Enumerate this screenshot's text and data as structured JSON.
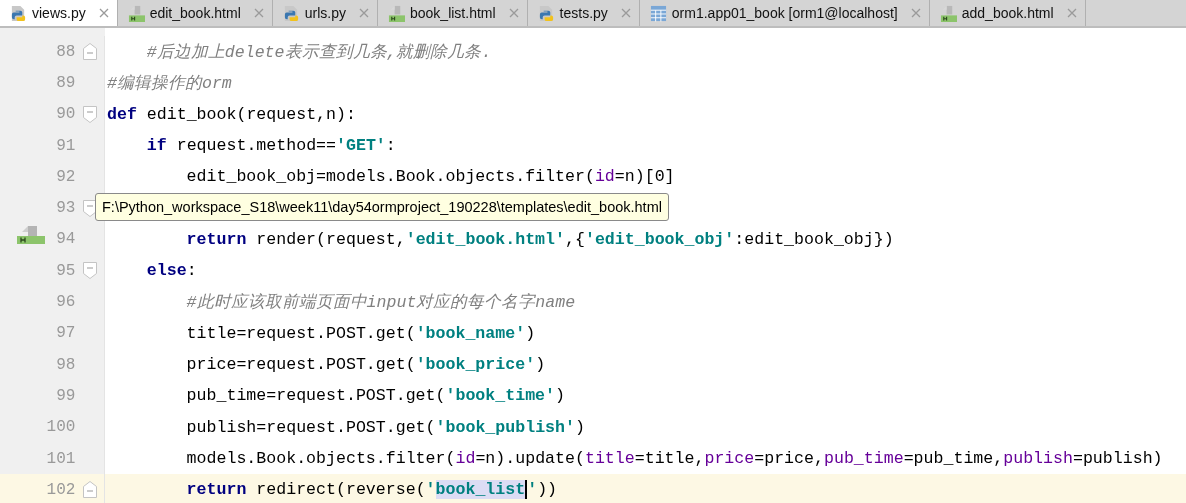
{
  "tabs": [
    {
      "label": "views.py",
      "kind": "python",
      "selected": true
    },
    {
      "label": "edit_book.html",
      "kind": "html",
      "selected": false
    },
    {
      "label": "urls.py",
      "kind": "python",
      "selected": false
    },
    {
      "label": "book_list.html",
      "kind": "html",
      "selected": false
    },
    {
      "label": "tests.py",
      "kind": "python",
      "selected": false
    },
    {
      "label": "orm1.app01_book [orm1@localhost]",
      "kind": "table",
      "selected": false
    },
    {
      "label": "add_book.html",
      "kind": "html",
      "selected": false
    }
  ],
  "blocks": [
    {
      "children": [
        {
          "number": "88",
          "gutter_icon": {
            "kind": "fold_end"
          },
          "tokens": [
            {
              "kind": "comment",
              "text": "#后边加上delete表示查到几条,就删除几条."
            }
          ]
        }
      ]
    },
    {
      "number": "89",
      "tokens": [
        {
          "kind": "comment",
          "text": "#编辑操作的orm"
        }
      ]
    },
    {
      "number": "90",
      "gutter_icon": {
        "kind": "fold_start"
      },
      "tokens": [
        {
          "kind": "keyword",
          "text": "def"
        },
        {
          "kind": "plain",
          "text": " edit_book(request,n):"
        }
      ],
      "children": [
        {
          "number": "91",
          "tokens": [
            {
              "kind": "keyword",
              "text": "if"
            },
            {
              "kind": "plain",
              "text": " request.method=="
            },
            {
              "kind": "string",
              "text": "'GET'"
            },
            {
              "kind": "plain",
              "text": ":"
            }
          ],
          "children": [
            {
              "number": "92",
              "tokens": [
                {
                  "kind": "plain",
                  "text": "edit_book_obj=models.Book.objects.filter("
                },
                {
                  "kind": "param",
                  "text": "id"
                },
                {
                  "kind": "plain",
                  "text": "=n)[0]"
                }
              ]
            },
            {
              "number": "93",
              "gutter_icon": {
                "kind": "fold_start"
              }
            },
            {
              "number": "94",
              "marker": {
                "kind": "html"
              },
              "tokens": [
                {
                  "kind": "keyword",
                  "text": "return"
                },
                {
                  "kind": "plain",
                  "text": " render(request,"
                },
                {
                  "kind": "string",
                  "text": "'edit_book.html'"
                },
                {
                  "kind": "plain",
                  "text": ",{"
                },
                {
                  "kind": "string",
                  "text": "'edit_book_obj'"
                },
                {
                  "kind": "plain",
                  "text": ":edit_book_obj})"
                }
              ]
            }
          ]
        },
        {
          "number": "95",
          "gutter_icon": {
            "kind": "fold_start"
          },
          "tokens": [
            {
              "kind": "keyword",
              "text": "else"
            },
            {
              "kind": "plain",
              "text": ":"
            }
          ],
          "children": [
            {
              "number": "96",
              "tokens": [
                {
                  "kind": "comment",
                  "text": "#此时应该取前端页面中input对应的每个名字name"
                }
              ]
            },
            {
              "number": "97",
              "tokens": [
                {
                  "kind": "plain",
                  "text": "title=request.POST.get("
                },
                {
                  "kind": "string",
                  "text": "'book_name'"
                },
                {
                  "kind": "plain",
                  "text": ")"
                }
              ]
            },
            {
              "number": "98",
              "tokens": [
                {
                  "kind": "plain",
                  "text": "price=request.POST.get("
                },
                {
                  "kind": "string",
                  "text": "'book_price'"
                },
                {
                  "kind": "plain",
                  "text": ")"
                }
              ]
            },
            {
              "number": "99",
              "tokens": [
                {
                  "kind": "plain",
                  "text": "pub_time=request.POST.get("
                },
                {
                  "kind": "string",
                  "text": "'book_time'"
                },
                {
                  "kind": "plain",
                  "text": ")"
                }
              ]
            },
            {
              "number": "100",
              "tokens": [
                {
                  "kind": "plain",
                  "text": "publish=request.POST.get("
                },
                {
                  "kind": "string",
                  "text": "'book_publish'"
                },
                {
                  "kind": "plain",
                  "text": ")"
                }
              ]
            },
            {
              "number": "101",
              "tokens": [
                {
                  "kind": "plain",
                  "text": "models.Book.objects.filter("
                },
                {
                  "kind": "param",
                  "text": "id"
                },
                {
                  "kind": "plain",
                  "text": "=n).update("
                },
                {
                  "kind": "param",
                  "text": "title"
                },
                {
                  "kind": "plain",
                  "text": "=title,"
                },
                {
                  "kind": "param",
                  "text": "price"
                },
                {
                  "kind": "plain",
                  "text": "=price,"
                },
                {
                  "kind": "param",
                  "text": "pub_time"
                },
                {
                  "kind": "plain",
                  "text": "=pub_time,"
                },
                {
                  "kind": "param",
                  "text": "publish"
                },
                {
                  "kind": "plain",
                  "text": "=publish)"
                }
              ]
            },
            {
              "number": "102",
              "gutter_icon": {
                "kind": "fold_end"
              },
              "current": true,
              "tokens": [
                {
                  "kind": "keyword",
                  "text": "return"
                },
                {
                  "kind": "plain",
                  "text": " redirect(reverse("
                },
                {
                  "kind": "string",
                  "text": "'"
                },
                {
                  "kind": "string",
                  "text": "book_list",
                  "highlighted": true
                },
                {
                  "kind": "string",
                  "text": "'"
                },
                {
                  "kind": "plain",
                  "text": "))"
                }
              ]
            }
          ]
        }
      ]
    }
  ],
  "tooltip": {
    "text": "F:\\Python_workspace_S18\\week11\\day54ormproject_190228\\templates\\edit_book.html"
  }
}
